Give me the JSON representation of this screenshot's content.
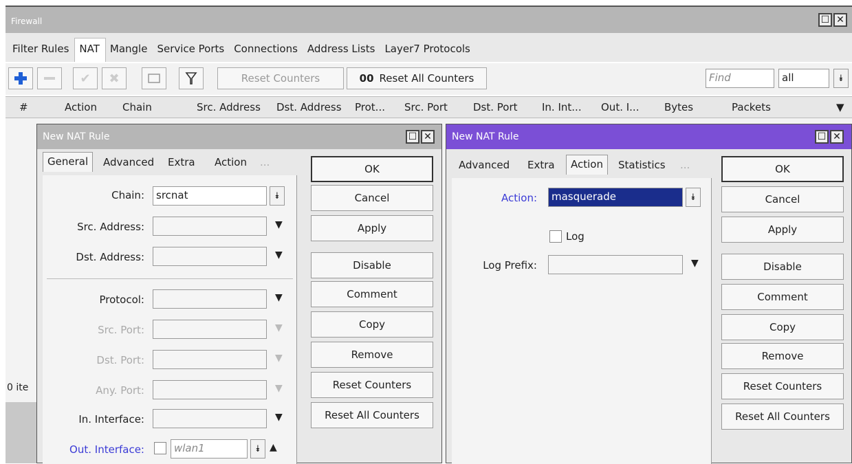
{
  "firewall": {
    "title": "Firewall",
    "tabs": [
      "Filter Rules",
      "NAT",
      "Mangle",
      "Service Ports",
      "Connections",
      "Address Lists",
      "Layer7 Protocols"
    ],
    "toolbar": {
      "reset_counters": "Reset Counters",
      "reset_all_counters": "Reset All Counters",
      "reset_all_prefix": "00",
      "find_placeholder": "Find",
      "filter_value": "all"
    },
    "columns": [
      "#",
      "Action",
      "Chain",
      "Src. Address",
      "Dst. Address",
      "Prot...",
      "Src. Port",
      "Dst. Port",
      "In. Int...",
      "Out. I...",
      "Bytes",
      "Packets"
    ],
    "status": "0 ite"
  },
  "dialog_left": {
    "title": "New NAT Rule",
    "tabs": [
      "General",
      "Advanced",
      "Extra",
      "Action",
      "..."
    ],
    "fields": {
      "chain_label": "Chain:",
      "chain_value": "srcnat",
      "src_address_label": "Src. Address:",
      "dst_address_label": "Dst. Address:",
      "protocol_label": "Protocol:",
      "src_port_label": "Src. Port:",
      "dst_port_label": "Dst. Port:",
      "any_port_label": "Any. Port:",
      "in_interface_label": "In. Interface:",
      "out_interface_label": "Out. Interface:",
      "out_interface_value": "wlan1"
    },
    "buttons": [
      "OK",
      "Cancel",
      "Apply",
      "Disable",
      "Comment",
      "Copy",
      "Remove",
      "Reset Counters",
      "Reset All Counters"
    ]
  },
  "dialog_right": {
    "title": "New NAT Rule",
    "tabs": [
      "Advanced",
      "Extra",
      "Action",
      "Statistics",
      "..."
    ],
    "fields": {
      "action_label": "Action:",
      "action_value": "masquerade",
      "log_label": "Log",
      "log_prefix_label": "Log Prefix:"
    },
    "buttons": [
      "OK",
      "Cancel",
      "Apply",
      "Disable",
      "Comment",
      "Copy",
      "Remove",
      "Reset Counters",
      "Reset All Counters"
    ]
  },
  "colors": {
    "right_title_bar": "#7b4fd6",
    "label_blue": "#3b3bd6",
    "selection": "#1a2d8c"
  }
}
